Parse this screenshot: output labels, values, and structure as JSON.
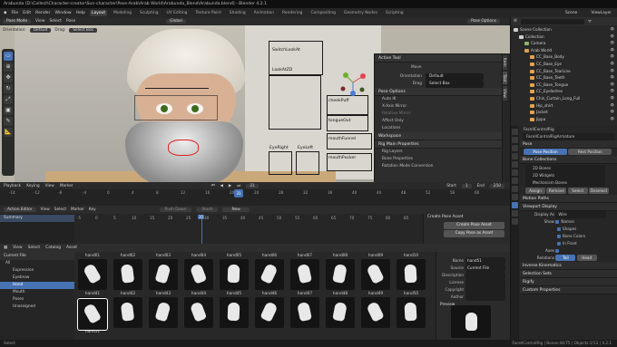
{
  "window": {
    "title": "Arabunda [D:\\Collect\\Character-creator\\Sun-character\\Pose-Arab\\Arab World\\Arabunda_Blend\\Arabunda.blend] - Blender 4.2.1",
    "menu": [
      "File",
      "Edit",
      "Render",
      "Window",
      "Help"
    ],
    "workspaces": [
      "Layout",
      "Modeling",
      "Sculpting",
      "UV Editing",
      "Texture Paint",
      "Shading",
      "Animation",
      "Rendering",
      "Compositing",
      "Geometry Nodes",
      "Scripting"
    ],
    "active_workspace": "Layout",
    "scene_label": "Scene",
    "view_layer_label": "ViewLayer"
  },
  "viewport": {
    "mode": "Pose Mode",
    "header_items": [
      "View",
      "Select",
      "Pose"
    ],
    "orientation_label": "Orientation:",
    "orientation_value": "Default",
    "drag_label": "Drag:",
    "drag_value": "Select Box",
    "transform": "Global",
    "pose_options_label": "Pose Options",
    "tools": [
      "select-box",
      "cursor",
      "move",
      "rotate",
      "scale",
      "transform",
      "annotate",
      "measure"
    ],
    "controller_labels": [
      "SwitchLookAt",
      "LookAtZD",
      "cheekPuff",
      "tongueOut",
      "mouthFunnel",
      "mouthPucker",
      "EyeRight",
      "EyeLeft"
    ],
    "npanel": {
      "active_tool_header": "Active Tool",
      "tool_name": "Move",
      "orientation_label": "Orientation",
      "orientation_value": "Default",
      "drag_label": "Drag",
      "drag_value": "Select Box",
      "pose_options_header": "Pose Options",
      "auto_ik": "Auto IK",
      "x_axis_mirror": "X-Axis Mirror",
      "relative_mirror": "Relative Mirror",
      "affect_only": "Affect Only",
      "locations": "Locations",
      "workspace_header": "Workspace",
      "rig_main_props_header": "Rig Main Properties",
      "rig_layers": "Rig Layers",
      "bone_properties": "Bone Properties",
      "bone_shape": "Rotation Mode Conversion",
      "side_tabs": [
        "Item",
        "Tool",
        "View"
      ]
    }
  },
  "timeline": {
    "header": [
      "Playback",
      "Keying",
      "View",
      "Marker"
    ],
    "ticks": [
      -14,
      -12,
      -8,
      -4,
      0,
      4,
      8,
      12,
      16,
      20,
      24,
      28,
      32,
      36,
      40,
      44,
      48,
      52,
      56,
      60
    ],
    "current_frame": "31",
    "start_label": "Start",
    "start_value": "1",
    "end_label": "End",
    "end_value": "250"
  },
  "action_editor": {
    "mode": "Action Editor",
    "header": [
      "View",
      "Select",
      "Marker",
      "Key"
    ],
    "action_field": "Push Down",
    "stash": "Stash",
    "new": "New",
    "ticks": [
      -5,
      0,
      5,
      10,
      15,
      20,
      25,
      30,
      35,
      40,
      45,
      50,
      55,
      60,
      65,
      70,
      75,
      80,
      85
    ],
    "current_frame": "31",
    "summary_row": "Summary",
    "pose_library_header": "Create Pose Asset",
    "create_pose_asset": "Create Pose Asset",
    "copy_pose_as_asset": "Copy Pose as Asset"
  },
  "asset_browser": {
    "header": [
      "View",
      "Select",
      "Catalog",
      "Asset"
    ],
    "library": "Current File",
    "catalogs": [
      {
        "label": "All",
        "selected": false,
        "indent": 0
      },
      {
        "label": "Expression",
        "selected": false,
        "indent": 1
      },
      {
        "label": "Eyebrow",
        "selected": false,
        "indent": 1
      },
      {
        "label": "Hand",
        "selected": true,
        "indent": 1
      },
      {
        "label": "Mouth",
        "selected": false,
        "indent": 1
      },
      {
        "label": "Poses",
        "selected": false,
        "indent": 1
      },
      {
        "label": "Unassigned",
        "selected": false,
        "indent": 1
      }
    ],
    "row1": [
      "hand01",
      "hand02",
      "hand03",
      "hand04",
      "hand05",
      "hand06",
      "hand07",
      "hand08",
      "hand09",
      "hand10"
    ],
    "row2": [
      "hand41",
      "hand42",
      "hand43",
      "hand44",
      "hand45",
      "hand46",
      "hand47",
      "hand48",
      "hand49",
      "hand50"
    ],
    "row3": [
      "hand51"
    ],
    "metadata": {
      "name_label": "Name",
      "name_value": "hand51",
      "source_label": "Source",
      "source_value": "Current File",
      "description_label": "Description",
      "license_label": "License",
      "copyright_label": "Copyright",
      "author_label": "Author",
      "preview_label": "Preview",
      "tags_label": "Tags"
    }
  },
  "outliner": {
    "header": "Scene Collection",
    "items": [
      {
        "label": "Scene Collection",
        "indent": 0,
        "color": "#d0d0d0",
        "selected": false
      },
      {
        "label": "Collection",
        "indent": 1,
        "color": "#d0d0d0",
        "selected": false
      },
      {
        "label": "Camera",
        "indent": 2,
        "color": "#8fb46b",
        "selected": false
      },
      {
        "label": "Arab World",
        "indent": 2,
        "color": "#d8a05a",
        "selected": false
      },
      {
        "label": "CC_Base_Body",
        "indent": 3,
        "color": "#e4a34d",
        "selected": false
      },
      {
        "label": "CC_Base_Eye",
        "indent": 3,
        "color": "#e4a34d",
        "selected": false
      },
      {
        "label": "CC_Base_TearLine",
        "indent": 3,
        "color": "#e4a34d",
        "selected": false
      },
      {
        "label": "CC_Base_Teeth",
        "indent": 3,
        "color": "#e4a34d",
        "selected": false
      },
      {
        "label": "CC_Base_Tongue",
        "indent": 3,
        "color": "#e4a34d",
        "selected": false
      },
      {
        "label": "CC_Eyelashes",
        "indent": 3,
        "color": "#e4a34d",
        "selected": false
      },
      {
        "label": "Chin_Curtain_Long_Full",
        "indent": 3,
        "color": "#e4a34d",
        "selected": false
      },
      {
        "label": "Hip_shirt",
        "indent": 3,
        "color": "#e4a34d",
        "selected": false
      },
      {
        "label": "Jacket",
        "indent": 3,
        "color": "#e4a34d",
        "selected": false
      },
      {
        "label": "Jippa",
        "indent": 3,
        "color": "#e4a34d",
        "selected": false
      }
    ]
  },
  "properties": {
    "object_field": "FacellControlRig",
    "armature_field": "FacellControlRigArmature",
    "pose_section": "Pose",
    "pose_position": "Pose Position",
    "rest_position": "Rest Position",
    "bone_collections_section": "Bone Collections",
    "collections": [
      "2D Bones",
      "2D Widgets",
      "Mechanism Bones"
    ],
    "assign": "Assign",
    "remove": "Remove",
    "select": "Select",
    "deselect": "Deselect",
    "motion_paths": "Motion Paths",
    "viewport_display": "Viewport Display",
    "display_as_label": "Display As",
    "display_as_value": "Wire",
    "show_label": "Show",
    "show_items": [
      "Names",
      "Shapes",
      "Bone Colors",
      "In Front"
    ],
    "axes_label": "Axes",
    "relations_label": "Relations",
    "relations_tail": "Tail",
    "relations_head": "Head",
    "inverse_kinematics": "Inverse Kinematics",
    "selection_sets": "Selection Sets",
    "rigify": "Rigify",
    "custom_props": "Custom Properties"
  },
  "status_bar": {
    "left": "Select",
    "right": "FacellControlRig | Bones:44/75 | Objects:1/13 | 4.2.1"
  },
  "colors": {
    "accent": "#4772b3",
    "panel": "#2d2d2d",
    "background": "#1d1d1d"
  }
}
